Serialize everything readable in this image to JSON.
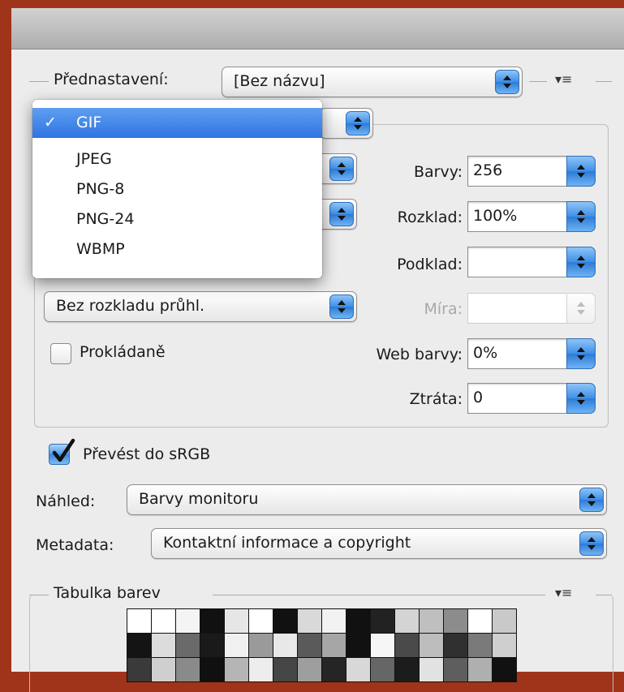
{
  "preset": {
    "label": "Přednastavení:",
    "value": "[Bez názvu]"
  },
  "format_menu": {
    "items": [
      "GIF",
      "JPEG",
      "PNG-8",
      "PNG-24",
      "WBMP"
    ],
    "selected_index": 0,
    "check_glyph": "✓"
  },
  "fields": {
    "colors": {
      "label": "Barvy:",
      "value": "256"
    },
    "dither": {
      "label": "Rozklad:",
      "value": "100%"
    },
    "matte": {
      "label": "Podklad:",
      "value": ""
    },
    "amount": {
      "label": "Míra:",
      "value": ""
    },
    "web_snap": {
      "label": "Web barvy:",
      "value": "0%"
    },
    "lossy": {
      "label": "Ztráta:",
      "value": "0"
    }
  },
  "transparency_dither": {
    "value": "Bez rozkladu průhl."
  },
  "interlaced": {
    "label": "Prokládaně",
    "checked": false
  },
  "convert_srgb": {
    "label": "Převést do sRGB",
    "checked": true
  },
  "preview": {
    "label": "Náhled:",
    "value": "Barvy monitoru"
  },
  "metadata": {
    "label": "Metadata:",
    "value": "Kontaktní informace a copyright"
  },
  "color_table": {
    "title": "Tabulka barev",
    "swatches": [
      "#ffffff",
      "#ffffff",
      "#f4f4f4",
      "#111111",
      "#e6e6e6",
      "#ffffff",
      "#111111",
      "#d9d9d9",
      "#f2f2f2",
      "#111111",
      "#222222",
      "#d4d4d4",
      "#bfbfbf",
      "#8c8c8c",
      "#ffffff",
      "#c9c9c9",
      "#141414",
      "#dcdcdc",
      "#6a6a6a",
      "#1a1a1a",
      "#f0f0f0",
      "#9a9a9a",
      "#e8e8e8",
      "#5a5a5a",
      "#a6a6a6",
      "#111111",
      "#f6f6f6",
      "#4a4a4a",
      "#bdbdbd",
      "#303030",
      "#7a7a7a",
      "#cfcfcf",
      "#3a3a3a",
      "#cfcfcf",
      "#8a8a8a",
      "#101010",
      "#b5b5b5",
      "#ededed",
      "#454545",
      "#9e9e9e",
      "#252525",
      "#d8d8d8",
      "#666666",
      "#1c1c1c",
      "#e2e2e2",
      "#5e5e5e",
      "#afafaf",
      "#111111"
    ]
  },
  "colors": {
    "accent": "#3a86da",
    "window_border": "#a0341a",
    "panel": "#ececec"
  },
  "icons": {
    "panel_menu": "panel-menu-icon",
    "stepper": "up-down-arrows-icon",
    "check": "checkmark-icon"
  }
}
